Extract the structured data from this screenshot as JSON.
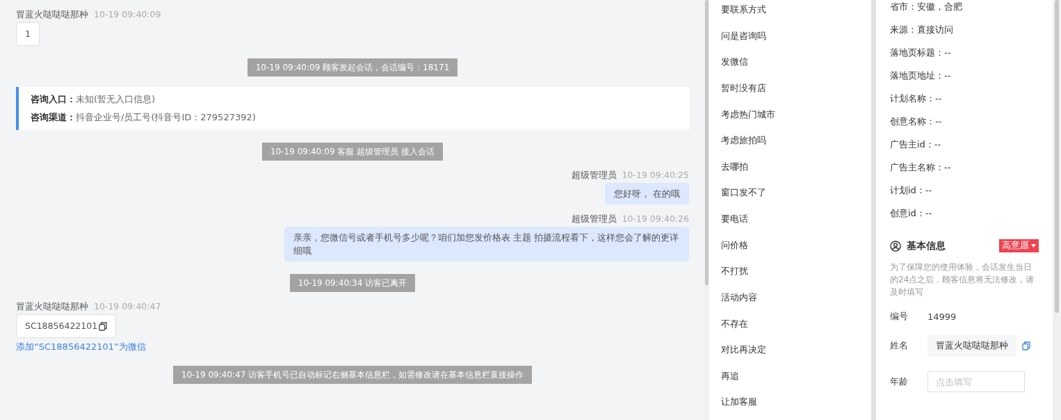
{
  "chat": {
    "messages": [
      {
        "kind": "customer",
        "sender": "冒蓝火哒哒哒那种",
        "time": "10-19 09:40:09",
        "content": "1",
        "copyable": false
      },
      {
        "kind": "system",
        "text": "10-19 09:40:09 顾客发起会话，会话编号：18171"
      },
      {
        "kind": "info",
        "lines": [
          {
            "label": "咨询入口：",
            "value": "未知(暂无入口信息)"
          },
          {
            "label": "咨询渠道：",
            "value": "抖音企业号/员工号(抖音号ID：279527392)"
          }
        ]
      },
      {
        "kind": "system",
        "text": "10-19 09:40:09 客服 超级管理员 接入会话"
      },
      {
        "kind": "agent",
        "sender": "超级管理员",
        "time": "10-19 09:40:25",
        "content": "您好呀， 在的哦"
      },
      {
        "kind": "agent",
        "sender": "超级管理员",
        "time": "10-19 09:40:26",
        "content": "亲亲，您微信号或者手机号多少呢？咱们加您发价格表 主题 拍摄流程看下，这样您会了解的更详细哦"
      },
      {
        "kind": "system",
        "text": "10-19 09:40:34 访客已离开"
      },
      {
        "kind": "customer",
        "sender": "冒蓝火哒哒哒那种",
        "time": "10-19 09:40:47",
        "content": "SC18856422101",
        "copyable": true,
        "link": "添加“SC18856422101”为微信"
      },
      {
        "kind": "system",
        "text": "10-19 09:40:47 访客手机号已自动标记右侧基本信息栏，如需修改请在基本信息栏直接操作"
      }
    ]
  },
  "quick_replies": [
    "要联系方式",
    "问是咨询吗",
    "发微信",
    "暂时没有店",
    "考虑热门城市",
    "考虑旅拍吗",
    "去哪拍",
    "窗口发不了",
    "要电话",
    "问价格",
    "不打扰",
    "活动内容",
    "不存在",
    "对比再决定",
    "再追",
    "让加客服"
  ],
  "source_info": [
    "省市：安徽，合肥",
    "来源：直接访问",
    "落地页标题：--",
    "落地页地址：--",
    "计划名称：--",
    "创意名称：--",
    "广告主id：--",
    "广告主名称：--",
    "计划id：--",
    "创意id：--"
  ],
  "basic_info": {
    "title": "基本信息",
    "intent_tag": "高意愿",
    "notice": "为了保障您的使用体验，会话发生当日的24点之后，顾客信息将无法修改，请及时填写",
    "fields": [
      {
        "kind": "text",
        "label": "编号",
        "value": "14999"
      },
      {
        "kind": "readonly",
        "label": "姓名",
        "value": "冒蓝火哒哒哒那种"
      },
      {
        "kind": "input",
        "label": "年龄",
        "placeholder": "点击填写"
      }
    ]
  }
}
